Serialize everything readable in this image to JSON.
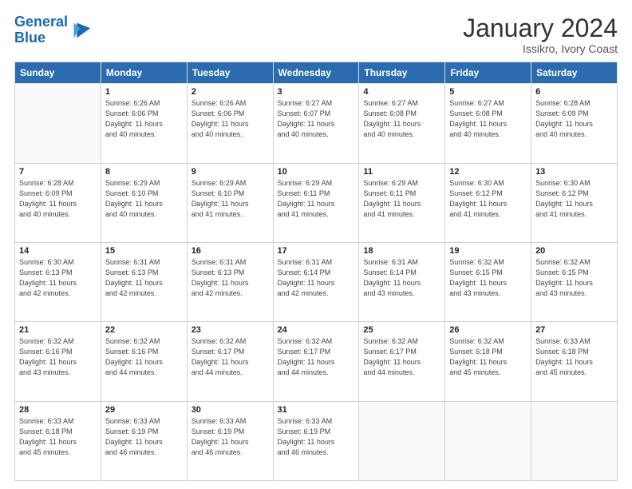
{
  "header": {
    "logo_text_general": "General",
    "logo_text_blue": "Blue",
    "month_title": "January 2024",
    "subtitle": "Issikro, Ivory Coast"
  },
  "days_of_week": [
    "Sunday",
    "Monday",
    "Tuesday",
    "Wednesday",
    "Thursday",
    "Friday",
    "Saturday"
  ],
  "weeks": [
    [
      {
        "day": "",
        "info": ""
      },
      {
        "day": "1",
        "info": "Sunrise: 6:26 AM\nSunset: 6:06 PM\nDaylight: 11 hours\nand 40 minutes."
      },
      {
        "day": "2",
        "info": "Sunrise: 6:26 AM\nSunset: 6:06 PM\nDaylight: 11 hours\nand 40 minutes."
      },
      {
        "day": "3",
        "info": "Sunrise: 6:27 AM\nSunset: 6:07 PM\nDaylight: 11 hours\nand 40 minutes."
      },
      {
        "day": "4",
        "info": "Sunrise: 6:27 AM\nSunset: 6:08 PM\nDaylight: 11 hours\nand 40 minutes."
      },
      {
        "day": "5",
        "info": "Sunrise: 6:27 AM\nSunset: 6:08 PM\nDaylight: 11 hours\nand 40 minutes."
      },
      {
        "day": "6",
        "info": "Sunrise: 6:28 AM\nSunset: 6:09 PM\nDaylight: 11 hours\nand 40 minutes."
      }
    ],
    [
      {
        "day": "7",
        "info": "Sunrise: 6:28 AM\nSunset: 6:09 PM\nDaylight: 11 hours\nand 40 minutes."
      },
      {
        "day": "8",
        "info": "Sunrise: 6:29 AM\nSunset: 6:10 PM\nDaylight: 11 hours\nand 40 minutes."
      },
      {
        "day": "9",
        "info": "Sunrise: 6:29 AM\nSunset: 6:10 PM\nDaylight: 11 hours\nand 41 minutes."
      },
      {
        "day": "10",
        "info": "Sunrise: 6:29 AM\nSunset: 6:11 PM\nDaylight: 11 hours\nand 41 minutes."
      },
      {
        "day": "11",
        "info": "Sunrise: 6:29 AM\nSunset: 6:11 PM\nDaylight: 11 hours\nand 41 minutes."
      },
      {
        "day": "12",
        "info": "Sunrise: 6:30 AM\nSunset: 6:12 PM\nDaylight: 11 hours\nand 41 minutes."
      },
      {
        "day": "13",
        "info": "Sunrise: 6:30 AM\nSunset: 6:12 PM\nDaylight: 11 hours\nand 41 minutes."
      }
    ],
    [
      {
        "day": "14",
        "info": "Sunrise: 6:30 AM\nSunset: 6:13 PM\nDaylight: 11 hours\nand 42 minutes."
      },
      {
        "day": "15",
        "info": "Sunrise: 6:31 AM\nSunset: 6:13 PM\nDaylight: 11 hours\nand 42 minutes."
      },
      {
        "day": "16",
        "info": "Sunrise: 6:31 AM\nSunset: 6:13 PM\nDaylight: 11 hours\nand 42 minutes."
      },
      {
        "day": "17",
        "info": "Sunrise: 6:31 AM\nSunset: 6:14 PM\nDaylight: 11 hours\nand 42 minutes."
      },
      {
        "day": "18",
        "info": "Sunrise: 6:31 AM\nSunset: 6:14 PM\nDaylight: 11 hours\nand 43 minutes."
      },
      {
        "day": "19",
        "info": "Sunrise: 6:32 AM\nSunset: 6:15 PM\nDaylight: 11 hours\nand 43 minutes."
      },
      {
        "day": "20",
        "info": "Sunrise: 6:32 AM\nSunset: 6:15 PM\nDaylight: 11 hours\nand 43 minutes."
      }
    ],
    [
      {
        "day": "21",
        "info": "Sunrise: 6:32 AM\nSunset: 6:16 PM\nDaylight: 11 hours\nand 43 minutes."
      },
      {
        "day": "22",
        "info": "Sunrise: 6:32 AM\nSunset: 6:16 PM\nDaylight: 11 hours\nand 44 minutes."
      },
      {
        "day": "23",
        "info": "Sunrise: 6:32 AM\nSunset: 6:17 PM\nDaylight: 11 hours\nand 44 minutes."
      },
      {
        "day": "24",
        "info": "Sunrise: 6:32 AM\nSunset: 6:17 PM\nDaylight: 11 hours\nand 44 minutes."
      },
      {
        "day": "25",
        "info": "Sunrise: 6:32 AM\nSunset: 6:17 PM\nDaylight: 11 hours\nand 44 minutes."
      },
      {
        "day": "26",
        "info": "Sunrise: 6:32 AM\nSunset: 6:18 PM\nDaylight: 11 hours\nand 45 minutes."
      },
      {
        "day": "27",
        "info": "Sunrise: 6:33 AM\nSunset: 6:18 PM\nDaylight: 11 hours\nand 45 minutes."
      }
    ],
    [
      {
        "day": "28",
        "info": "Sunrise: 6:33 AM\nSunset: 6:18 PM\nDaylight: 11 hours\nand 45 minutes."
      },
      {
        "day": "29",
        "info": "Sunrise: 6:33 AM\nSunset: 6:19 PM\nDaylight: 11 hours\nand 46 minutes."
      },
      {
        "day": "30",
        "info": "Sunrise: 6:33 AM\nSunset: 6:19 PM\nDaylight: 11 hours\nand 46 minutes."
      },
      {
        "day": "31",
        "info": "Sunrise: 6:33 AM\nSunset: 6:19 PM\nDaylight: 11 hours\nand 46 minutes."
      },
      {
        "day": "",
        "info": ""
      },
      {
        "day": "",
        "info": ""
      },
      {
        "day": "",
        "info": ""
      }
    ]
  ]
}
